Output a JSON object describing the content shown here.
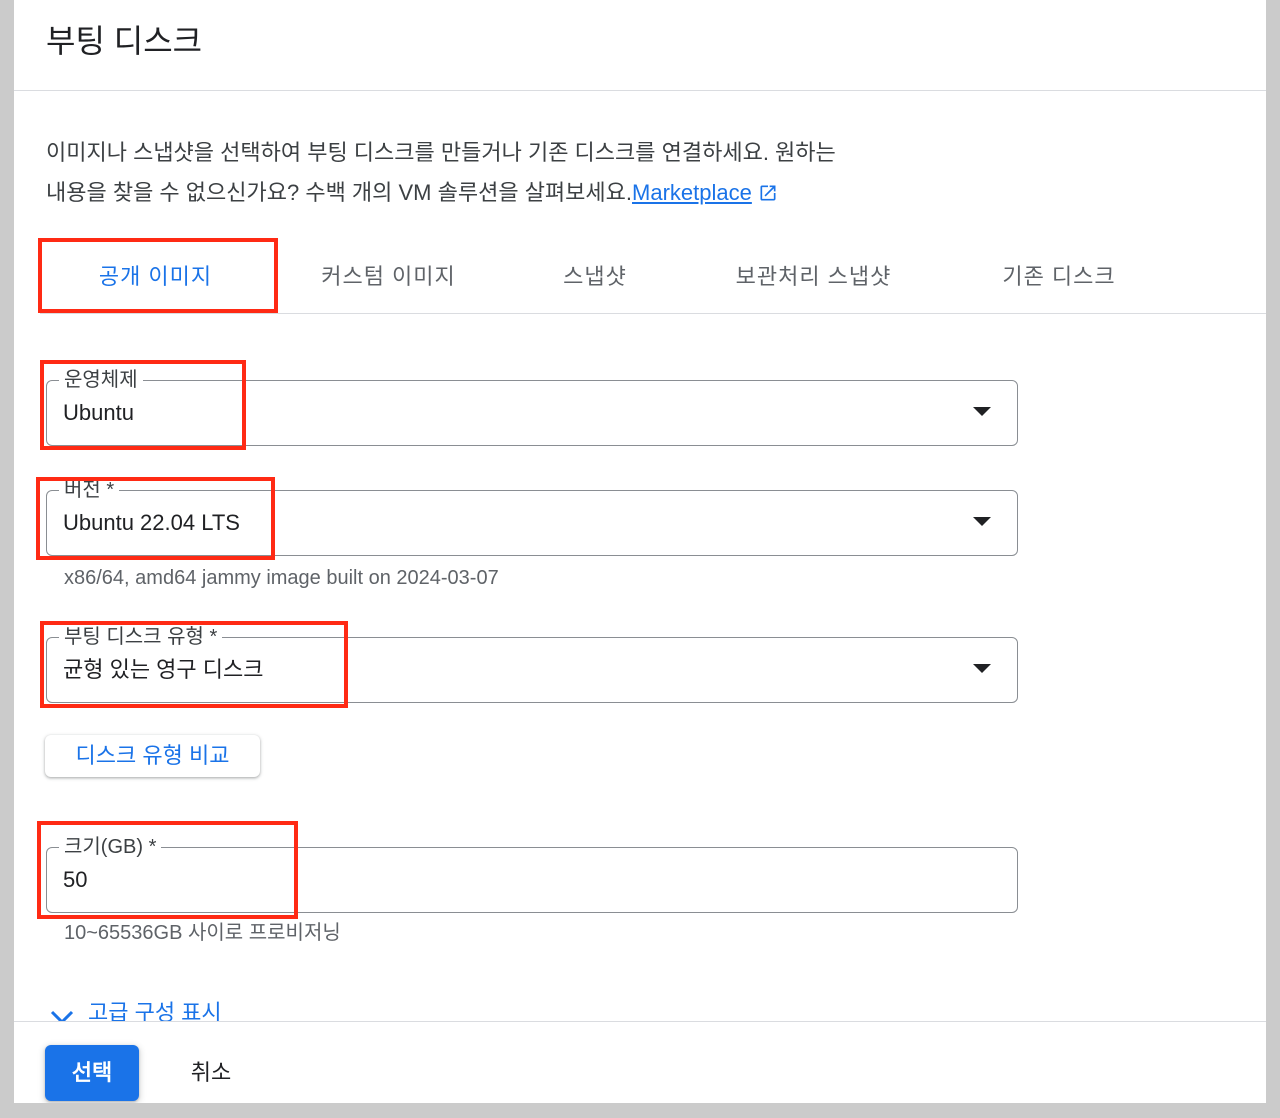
{
  "app": {
    "title": "부팅 디스크"
  },
  "description": {
    "line1": "이미지나 스냅샷을 선택하여 부팅 디스크를 만들거나 기존 디스크를 연결하세요. 원하는",
    "line2": "내용을 찾을 수 없으신가요? 수백 개의 VM 솔루션을 살펴보세요.",
    "link_label": "Marketplace",
    "link_icon": "open-in-new-icon"
  },
  "tabs": [
    {
      "label": "공개 이미지",
      "selected": true
    },
    {
      "label": "커스텀 이미지",
      "selected": false
    },
    {
      "label": "스냅샷",
      "selected": false
    },
    {
      "label": "보관처리 스냅샷",
      "selected": false
    },
    {
      "label": "기존 디스크",
      "selected": false
    }
  ],
  "form": {
    "os": {
      "label": "운영체제",
      "value": "Ubuntu",
      "icon": "dropdown-arrow-icon"
    },
    "version": {
      "label": "버전 *",
      "value": "Ubuntu 22.04 LTS",
      "helper": "x86/64, amd64 jammy image built on 2024-03-07",
      "icon": "dropdown-arrow-icon"
    },
    "disk_type": {
      "label": "부팅 디스크 유형 *",
      "value": "균형 있는 영구 디스크",
      "icon": "dropdown-arrow-icon"
    },
    "compare_button": "디스크 유형 비교",
    "size": {
      "label": "크기(GB) *",
      "value": "50",
      "helper": "10~65536GB 사이로 프로비저닝"
    },
    "advanced_toggle": {
      "label": "고급 구성 표시",
      "icon": "chevron-down-icon"
    }
  },
  "footer": {
    "select_label": "선택",
    "cancel_label": "취소"
  },
  "colors": {
    "accent": "#1a73e8",
    "annotation": "#ff2a14"
  }
}
